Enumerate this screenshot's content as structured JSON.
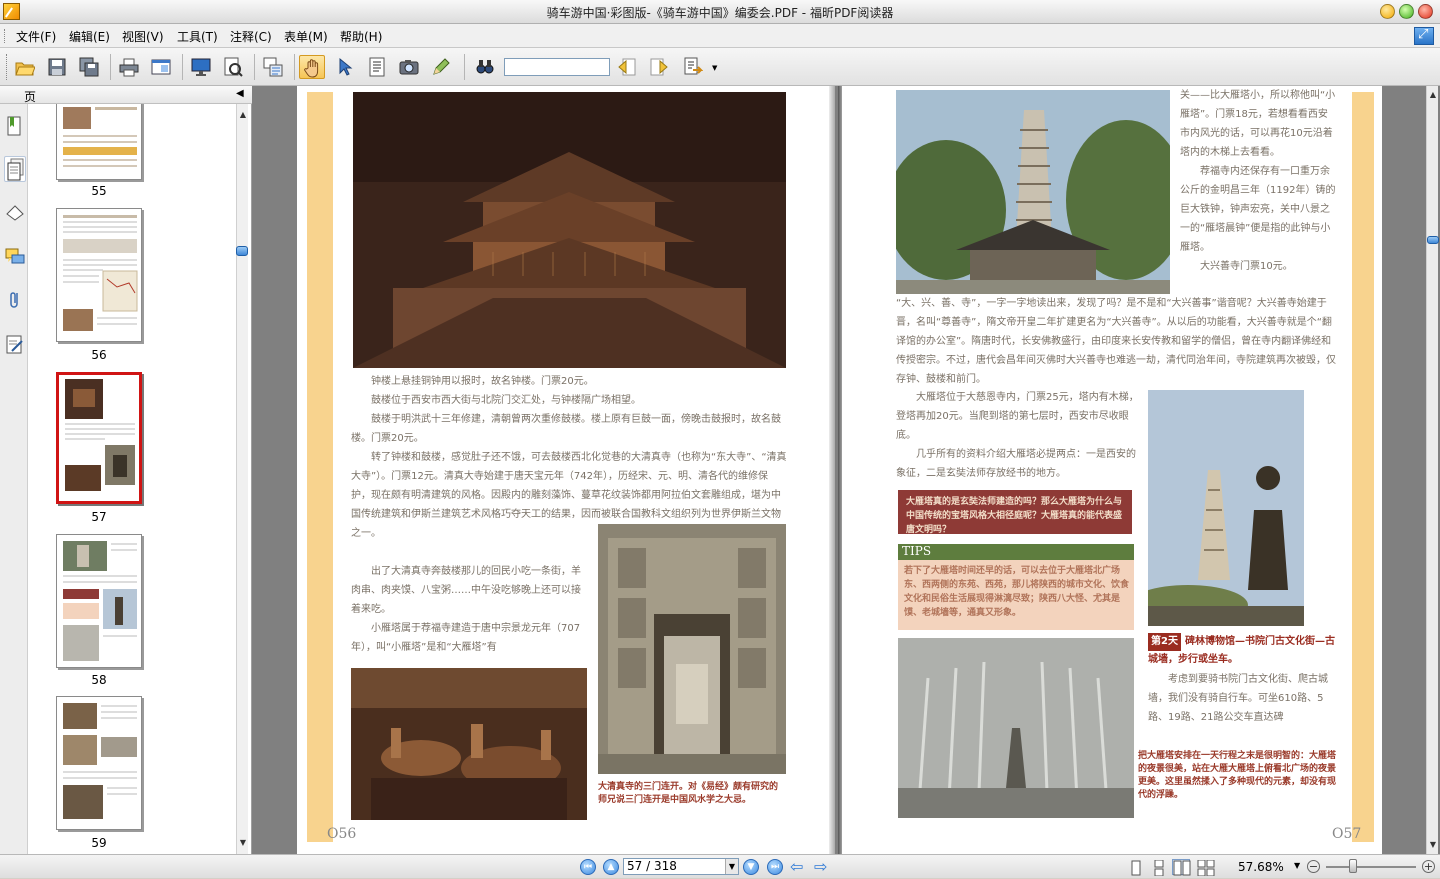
{
  "window": {
    "title": "骑车游中国·彩图版-《骑车游中国》编委会.PDF - 福昕PDF阅读器"
  },
  "menu": {
    "items": [
      "文件(F)",
      "编辑(E)",
      "视图(V)",
      "工具(T)",
      "注释(C)",
      "表单(M)",
      "帮助(H)"
    ]
  },
  "toolbar": {
    "buttons": [
      "open-icon",
      "save-icon",
      "save-all-icon",
      "print-icon",
      "fit-window-icon",
      "screen-icon",
      "zoom-page-icon",
      "reflow-icon",
      "hand-tool-icon",
      "select-arrow-icon",
      "text-select-icon",
      "snapshot-icon",
      "edit-icon",
      "find-icon",
      "find-prev-icon",
      "find-next-icon",
      "export-icon"
    ],
    "search_value": ""
  },
  "sidebar": {
    "header_label": "页",
    "tabs": [
      "bookmark-icon",
      "pages-icon",
      "layers-icon",
      "comments-icon",
      "attachments-icon",
      "signature-icon"
    ],
    "thumbnails": [
      {
        "page": "55"
      },
      {
        "page": "56"
      },
      {
        "page": "57",
        "selected": true
      },
      {
        "page": "58"
      },
      {
        "page": "59"
      }
    ]
  },
  "document": {
    "left_page": {
      "number": "O56",
      "paragraphs": [
        "钟楼上悬挂铜钟用以报时，故名钟楼。门票20元。",
        "鼓楼位于西安市西大街与北院门交汇处，与钟楼隔广场相望。",
        "鼓楼于明洪武十三年修建，清朝曾两次重修鼓楼。楼上原有巨鼓一面，傍晚击鼓报时，故名鼓楼。门票20元。",
        "转了钟楼和鼓楼，感觉肚子还不饿，可去鼓楼西北化觉巷的大清真寺（也称为“东大寺”、“清真大寺”）。门票12元。清真大寺始建于唐天宝元年（742年），历经宋、元、明、清各代的维修保护，现在颇有明清建筑的风格。因殿内的雕刻藻饰、蔓草花纹装饰都用阿拉伯文套雕组成，堪为中国传统建筑和伊斯兰建筑艺术风格巧夺天工的结果，因而被联合国教科文组织列为世界伊斯兰文物之一。",
        "出了大清真寺奔鼓楼那儿的回民小吃一条街，羊肉串、肉夹馍、八宝粥……中午没吃够晚上还可以接着来吃。",
        "小雁塔属于荐福寺建造于唐中宗景龙元年（707年），叫“小雁塔”是和“大雁塔”有"
      ],
      "caption": "大清真寺的三门连开。对《易经》颇有研究的师兄说三门连开是中国风水学之大忌。"
    },
    "right_page": {
      "number": "O57",
      "top_paragraphs": [
        "关——比大雁塔小，所以称他叫“小雁塔”。门票18元，若想看看西安市内风光的话，可以再花10元沿着塔内的木梯上去看看。",
        "荐福寺内还保存有一口重万余公斤的金明昌三年（1192年）铸的巨大铁钟，钟声宏亮，关中八景之一的“雁塔晨钟”便是指的此钟与小雁塔。",
        "大兴善寺门票10元。"
      ],
      "middle_paragraph": "“大、兴、善、寺”，一字一字地读出来，发现了吗？是不是和“大兴善事”谐音呢？大兴善寺始建于晋，名叫“尊善寺”，隋文帝开皇二年扩建更名为“大兴善寺”。从以后的功能看，大兴善寺就是个“翻译馆的办公室”。隋唐时代，长安佛教盛行，由印度来长安传教和留学的僧侣，曾在寺内翻译佛经和传授密宗。不过，唐代会昌年间灭佛时大兴善寺也难逃一劫，清代同治年间，寺院建筑再次被毁，仅存钟、鼓楼和前门。",
      "wild_goose_paragraphs": [
        "大雁塔位于大慈恩寺内，门票25元，塔内有木梯，登塔再加20元。当爬到塔的第七层时，西安市尽收眼底。",
        "几乎所有的资料介绍大雁塔必提两点：一是西安的象征，二是玄奘法师存放经书的地方。"
      ],
      "question_box": "大雁塔真的是玄奘法师建造的吗？那么大雁塔为什么与中国传统的宝塔风格大相径庭呢？大雁塔真的能代表盛唐文明吗？",
      "tips_title": "TIPS",
      "tips_text": "若下了大雁塔时间还早的话，可以去位于大雁塔北广场东、西两侧的东苑、西苑，那儿将陕西的城市文化、饮食文化和民俗生活展现得淋漓尽致；陕西八大怪、尤其是馍、老城墙等，通真又形象。",
      "section_badge": "第2天",
      "section_title": "碑林博物馆—书院门古文化街—古城墙，步行或坐车。",
      "section_paragraph": "考虑到要骑书院门古文化街、爬古城墙，我们没有骑自行车。可坐610路、5路、19路、21路公交车直达碑",
      "bottom_caption": "把大雁塔安排在一天行程之末是很明智的：大雁塔的夜景很美，站在大雁大雁塔上俯看北广场的夜景更美。这里虽然揉入了多种现代的元素，却没有现代的浮躁。"
    }
  },
  "statusbar": {
    "page_field": "57 / 318",
    "zoom": "57.68%",
    "zoom_level": 0.3
  }
}
